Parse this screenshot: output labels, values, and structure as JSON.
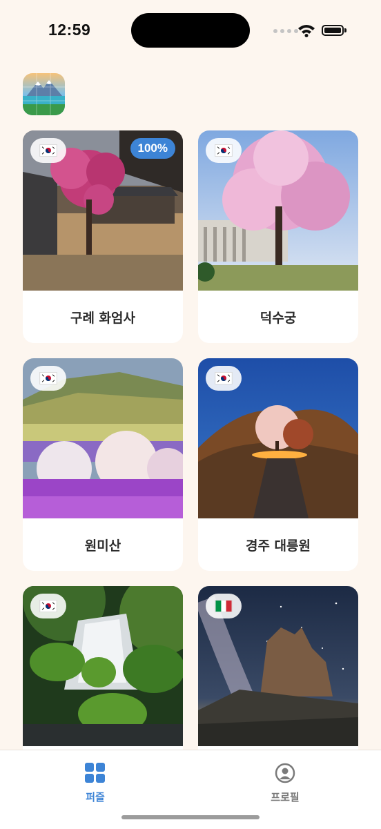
{
  "status_bar": {
    "time": "12:59"
  },
  "header": {
    "app_icon": "mountain-lake-puzzle-icon"
  },
  "cards": [
    {
      "title": "구례 화엄사",
      "country": "KR",
      "progress": "100%"
    },
    {
      "title": "덕수궁",
      "country": "KR"
    },
    {
      "title": "원미산",
      "country": "KR"
    },
    {
      "title": "경주 대릉원",
      "country": "KR"
    },
    {
      "title": "",
      "country": "KR"
    },
    {
      "title": "",
      "country": "IT"
    }
  ],
  "tab_bar": {
    "tabs": [
      {
        "label": "퍼즐",
        "icon": "grid-icon",
        "active": true
      },
      {
        "label": "프로필",
        "icon": "profile-icon",
        "active": false
      }
    ]
  },
  "colors": {
    "accent": "#3d84d6",
    "background": "#fdf6ef"
  }
}
